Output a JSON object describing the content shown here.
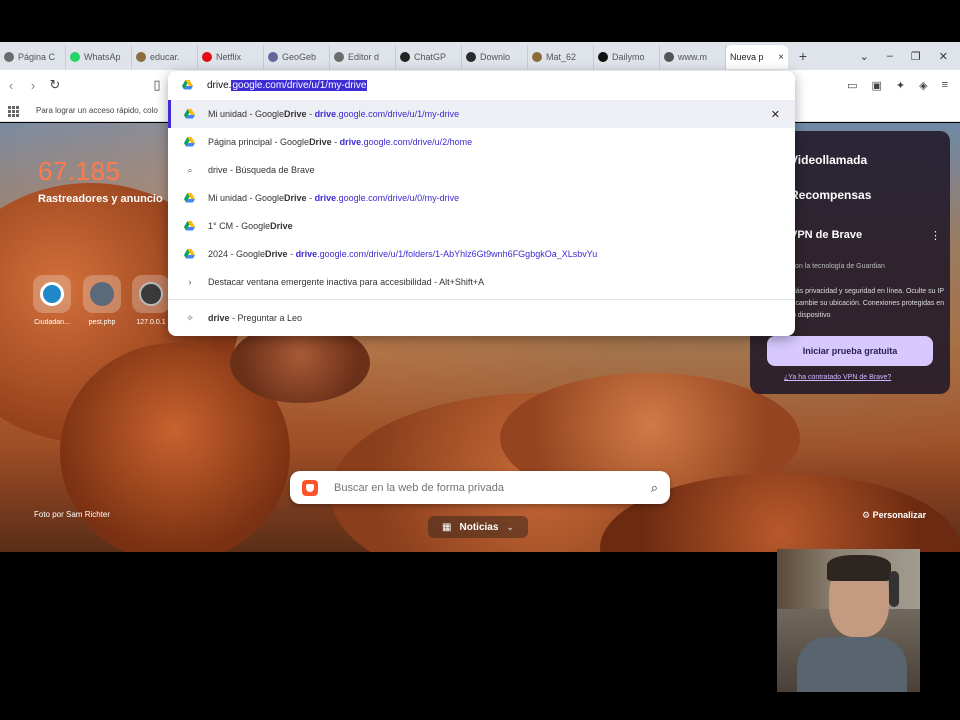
{
  "browser": {
    "tabs": [
      {
        "label": "Página C",
        "icon": "globe-icon",
        "color": "#6b6b6b"
      },
      {
        "label": "WhatsAp",
        "icon": "whatsapp-icon",
        "color": "#25d366"
      },
      {
        "label": "educar.",
        "icon": "page-icon",
        "color": "#8a6d3b"
      },
      {
        "label": "Netflix",
        "icon": "netflix-icon",
        "color": "#e50914"
      },
      {
        "label": "GeoGeb",
        "icon": "geogebra-icon",
        "color": "#666699"
      },
      {
        "label": "Editor d",
        "icon": "globe-icon",
        "color": "#6b6b6b"
      },
      {
        "label": "ChatGP",
        "icon": "chatgpt-icon",
        "color": "#222222"
      },
      {
        "label": "Downlo",
        "icon": "download-icon",
        "color": "#2b2b2b"
      },
      {
        "label": "Mat_62",
        "icon": "page-icon",
        "color": "#8a6d3b"
      },
      {
        "label": "Dailymo",
        "icon": "dailymotion-icon",
        "color": "#111111"
      },
      {
        "label": "www.m",
        "icon": "link-icon",
        "color": "#555555"
      }
    ],
    "active_tab": {
      "label": "Nueva p",
      "close": "×"
    },
    "new_tab": "+",
    "window_controls": {
      "dropdown": "⌄",
      "minimize": "–",
      "restore": "❐",
      "close": "✕"
    }
  },
  "bookmarks_bar": {
    "hint": "Para lograr un acceso rápido, colo"
  },
  "omnibox": {
    "typed": "drive.",
    "selected_completion": "google.com/drive/u/1/my-drive",
    "suggestions": [
      {
        "icon": "google-drive-icon",
        "title": "Mi unidad - Google ",
        "bold": "Drive",
        "sep": " - ",
        "url_bold": "drive",
        "url": ".google.com/drive/u/1/my-drive",
        "highlighted": true,
        "close": "✕"
      },
      {
        "icon": "google-drive-icon",
        "title": "Página principal - Google ",
        "bold": "Drive",
        "sep": " - ",
        "url_bold": "drive",
        "url": ".google.com/drive/u/2/home",
        "highlighted": false
      },
      {
        "icon": "search-icon",
        "title": "drive - Búsqueda de Brave",
        "bold": "",
        "sep": "",
        "url_bold": "",
        "url": "",
        "highlighted": false
      },
      {
        "icon": "google-drive-icon",
        "title": "Mi unidad - Google ",
        "bold": "Drive",
        "sep": " - ",
        "url_bold": "drive",
        "url": ".google.com/drive/u/0/my-drive",
        "highlighted": false
      },
      {
        "icon": "google-drive-icon",
        "title": "1° CM - Google ",
        "bold": "Drive",
        "sep": "",
        "url_bold": "",
        "url": "",
        "highlighted": false
      },
      {
        "icon": "google-drive-icon",
        "title": "2024 - Google ",
        "bold": "Drive",
        "sep": " - ",
        "url_bold": "drive",
        "url": ".google.com/drive/u/1/folders/1-AbYhlz6Gt9wnh6FGgbgkOa_XLsbvYu",
        "highlighted": false
      },
      {
        "icon": "chevron-right-icon",
        "title": "Destacar ventana emergente inactiva para accesibilidad - Alt+Shift+A",
        "bold": "",
        "sep": "",
        "url_bold": "",
        "url": "",
        "highlighted": false
      }
    ],
    "leo": {
      "icon": "leo-icon",
      "bold": "drive",
      "text": " - Preguntar a Leo"
    }
  },
  "ntp": {
    "stat_value": "67.185",
    "stat_label": "Rastreadores y anuncio",
    "sites": [
      {
        "label": "Ciudadan...",
        "color": "#1e88c8"
      },
      {
        "label": "pest.php",
        "color": "#5a6a7a"
      },
      {
        "label": "127.0.0.1",
        "color": "#3a3a3a"
      }
    ],
    "photo_credit": "Foto por Sam Richter",
    "customize": "Personalizar",
    "search_placeholder": "Buscar en la web de forma privada",
    "news_button": "Noticias",
    "cards": {
      "videollamada": "Videollamada",
      "recompensas": "Recompensas",
      "vpn_title": "VPN de Brave",
      "vpn_menu": "⋮",
      "vpn_powered": "Con la tecnología de  Guardian",
      "vpn_desc": "Más privacidad y seguridad en línea. Oculte su IP y cambie su ubicación. Conexiones protegidas en tu dispositivo",
      "vpn_trial_button": "Iniciar prueba gratuita",
      "vpn_link": "¿Ya ha contratado VPN de Brave?"
    }
  },
  "colors": {
    "accent": "#3d2bd6",
    "brave_orange": "#fb542b",
    "stat": "#ff7a4d"
  }
}
